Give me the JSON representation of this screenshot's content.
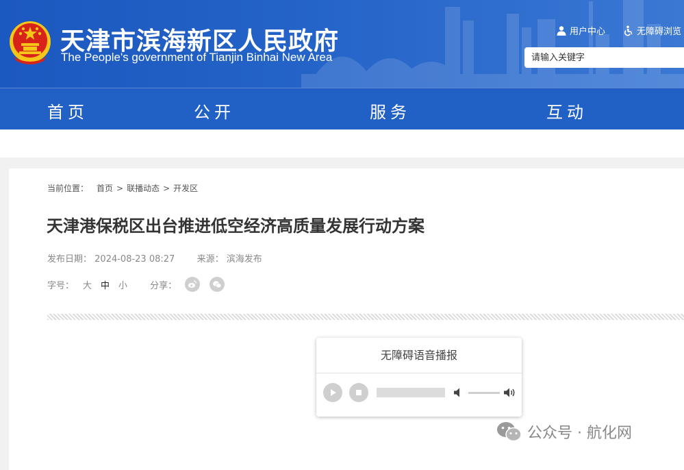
{
  "header": {
    "title": "天津市滨海新区人民政府",
    "subtitle": "The People's government of Tianjin Binhai New Area",
    "links": [
      {
        "label": "用户中心",
        "icon": "user-icon"
      },
      {
        "label": "无障碍浏览",
        "icon": "accessibility-icon"
      }
    ],
    "search": {
      "placeholder": "请输入关键字",
      "value": ""
    }
  },
  "nav": {
    "items": [
      {
        "label": "首页"
      },
      {
        "label": "公开"
      },
      {
        "label": "服务"
      },
      {
        "label": "互动"
      }
    ]
  },
  "breadcrumb": {
    "label": "当前位置：",
    "items": [
      "首页",
      "联播动态",
      "开发区"
    ],
    "separator": ">"
  },
  "article": {
    "title": "天津港保税区出台推进低空经济高质量发展行动方案",
    "date_label": "发布日期：",
    "date": "2024-08-23 08:27",
    "source_label": "来源：",
    "source": "滨海发布",
    "font_size_label": "字号：",
    "font_sizes": [
      "大",
      "中",
      "小"
    ],
    "active_font_size": "中",
    "share_label": "分享：",
    "share_icons": [
      "weibo-icon",
      "wechat-icon"
    ]
  },
  "player": {
    "title": "无障碍语音播报",
    "progress": 0,
    "volume": 1.0
  },
  "watermark": {
    "text": "公众号 · 航化网",
    "icon": "wechat-logo-icon"
  },
  "colors": {
    "header_blue": "#1b58bf",
    "nav_blue": "#2160c4",
    "emblem_red": "#d8231a",
    "emblem_gold": "#f5c518"
  }
}
